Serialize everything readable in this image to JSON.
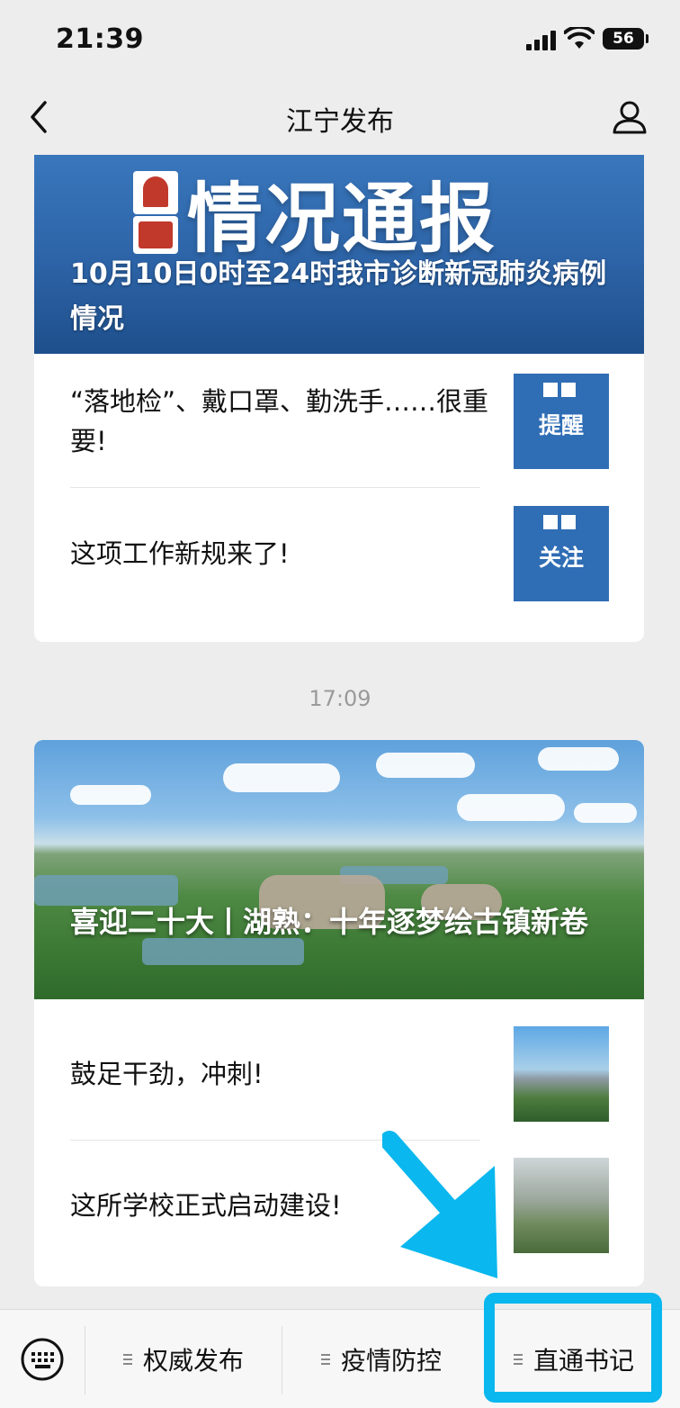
{
  "status_bar": {
    "time": "21:39",
    "battery": "56"
  },
  "nav": {
    "title": "江宁发布"
  },
  "card1": {
    "hero_title": "情况通报",
    "hero_caption": "10月10日0时至24时我市诊断新冠肺炎病例情况",
    "items": [
      {
        "title": "“落地检”、戴口罩、勤洗手……很重要!",
        "thumb_text": "提醒"
      },
      {
        "title": "这项工作新规来了!",
        "thumb_text": "关注"
      }
    ]
  },
  "timestamp": "17:09",
  "card2": {
    "hero_caption": "喜迎二十大丨湖熟：十年逐梦绘古镇新卷",
    "items": [
      {
        "title": "鼓足干劲，冲刺!"
      },
      {
        "title": "这所学校正式启动建设!"
      }
    ]
  },
  "menu": {
    "items": [
      {
        "label": "权威发布"
      },
      {
        "label": "疫情防控"
      },
      {
        "label": "直通书记"
      }
    ]
  },
  "colors": {
    "annotation": "#0ab7ee",
    "hero_blue": "#2d64a7"
  }
}
